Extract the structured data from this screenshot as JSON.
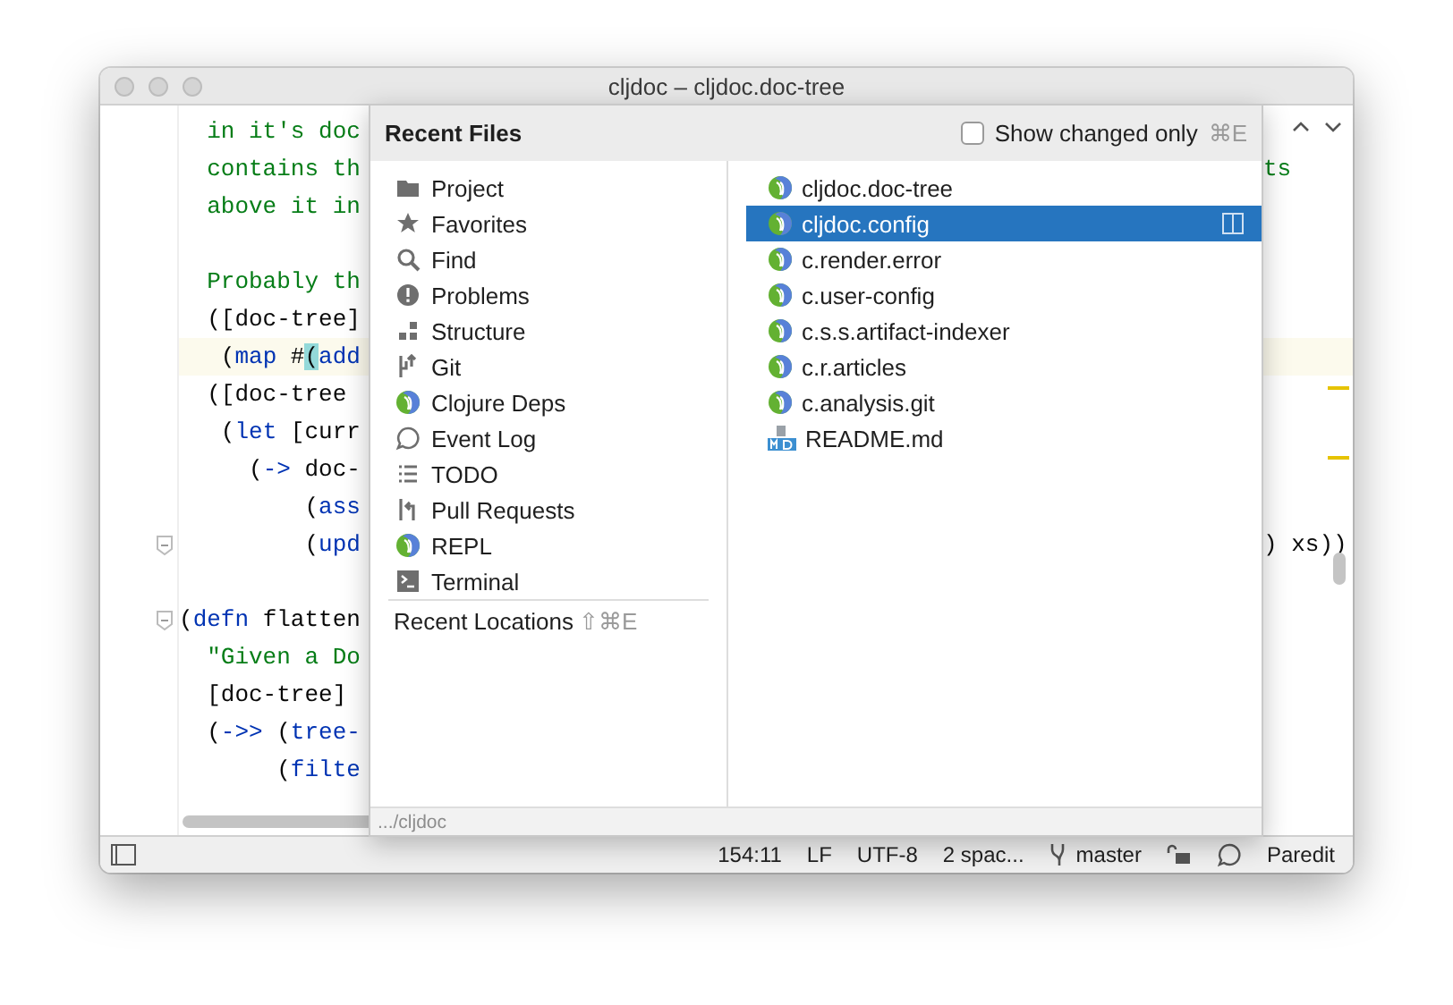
{
  "window": {
    "title": "cljdoc – cljdoc.doc-tree"
  },
  "editor": {
    "lines": [
      {
        "fold": false,
        "left": [
          {
            "kind": "string",
            "text": "  in it's doc"
          }
        ]
      },
      {
        "fold": false,
        "left": [
          {
            "kind": "string",
            "text": "  contains th"
          }
        ],
        "right": [
          {
            "kind": "string",
            "text": "ts"
          }
        ]
      },
      {
        "fold": false,
        "left": [
          {
            "kind": "string",
            "text": "  above it in"
          }
        ]
      },
      {
        "fold": false
      },
      {
        "fold": false,
        "left": [
          {
            "kind": "string",
            "text": "  Probably th"
          }
        ]
      },
      {
        "fold": false,
        "left": [
          {
            "kind": "plain",
            "text": "  ([doc-tree]"
          }
        ]
      },
      {
        "fold": false,
        "current": true,
        "left": [
          {
            "kind": "plain",
            "text": "   ("
          },
          {
            "kind": "keyword",
            "text": "map"
          },
          {
            "kind": "plain",
            "text": " #"
          },
          {
            "kind": "match",
            "text": "("
          },
          {
            "kind": "keyword",
            "text": "add"
          }
        ]
      },
      {
        "fold": false,
        "left": [
          {
            "kind": "plain",
            "text": "  ([doc-tree"
          }
        ]
      },
      {
        "fold": false,
        "left": [
          {
            "kind": "plain",
            "text": "   ("
          },
          {
            "kind": "keyword",
            "text": "let"
          },
          {
            "kind": "plain",
            "text": " [curr"
          }
        ]
      },
      {
        "fold": false,
        "left": [
          {
            "kind": "plain",
            "text": "     ("
          },
          {
            "kind": "keyword",
            "text": "->"
          },
          {
            "kind": "plain",
            "text": " doc-"
          }
        ]
      },
      {
        "fold": false,
        "left": [
          {
            "kind": "plain",
            "text": "         ("
          },
          {
            "kind": "keyword",
            "text": "ass"
          }
        ]
      },
      {
        "fold": true,
        "left": [
          {
            "kind": "plain",
            "text": "         ("
          },
          {
            "kind": "keyword",
            "text": "upd"
          }
        ],
        "right": [
          {
            "kind": "plain",
            "text": ") xs))"
          }
        ]
      },
      {
        "fold": false
      },
      {
        "fold": true,
        "left": [
          {
            "kind": "plain",
            "text": "("
          },
          {
            "kind": "keyword",
            "text": "defn"
          },
          {
            "kind": "plain",
            "text": " flatten"
          }
        ]
      },
      {
        "fold": false,
        "left": [
          {
            "kind": "string",
            "text": "  \"Given a Do"
          }
        ]
      },
      {
        "fold": false,
        "left": [
          {
            "kind": "plain",
            "text": "  [doc-tree]"
          }
        ]
      },
      {
        "fold": false,
        "left": [
          {
            "kind": "plain",
            "text": "  ("
          },
          {
            "kind": "keyword",
            "text": "->>"
          },
          {
            "kind": "plain",
            "text": " ("
          },
          {
            "kind": "keyword",
            "text": "tree-"
          }
        ]
      },
      {
        "fold": false,
        "left": [
          {
            "kind": "plain",
            "text": "       ("
          },
          {
            "kind": "keyword",
            "text": "filte"
          }
        ]
      }
    ]
  },
  "popup": {
    "title": "Recent Files",
    "show_changed": {
      "label": "Show changed only",
      "shortcut": "⌘E",
      "checked": false
    },
    "tool_windows": [
      {
        "label": "Project",
        "kind": "folder"
      },
      {
        "label": "Favorites",
        "kind": "star"
      },
      {
        "label": "Find",
        "kind": "search"
      },
      {
        "label": "Problems",
        "kind": "alert"
      },
      {
        "label": "Structure",
        "kind": "structure"
      },
      {
        "label": "Git",
        "kind": "vcs"
      },
      {
        "label": "Clojure Deps",
        "kind": "logo"
      },
      {
        "label": "Event Log",
        "kind": "bubble"
      },
      {
        "label": "TODO",
        "kind": "list"
      },
      {
        "label": "Pull Requests",
        "kind": "merge"
      },
      {
        "label": "REPL",
        "kind": "logo"
      },
      {
        "label": "Terminal",
        "kind": "terminal"
      }
    ],
    "recent_locations": {
      "label": "Recent Locations",
      "shortcut": "⇧⌘E"
    },
    "files": [
      {
        "name": "cljdoc.doc-tree",
        "kind": "clojure",
        "selected": false
      },
      {
        "name": "cljdoc.config",
        "kind": "clojure",
        "selected": true
      },
      {
        "name": "c.render.error",
        "kind": "clojure",
        "selected": false
      },
      {
        "name": "c.user-config",
        "kind": "clojure",
        "selected": false
      },
      {
        "name": "c.s.s.artifact-indexer",
        "kind": "clojure",
        "selected": false
      },
      {
        "name": "c.r.articles",
        "kind": "clojure",
        "selected": false
      },
      {
        "name": "c.analysis.git",
        "kind": "clojure",
        "selected": false
      },
      {
        "name": "README.md",
        "kind": "markdown",
        "selected": false
      }
    ],
    "path": ".../cljdoc"
  },
  "status_bar": {
    "position": "154:11",
    "line_separator": "LF",
    "encoding": "UTF-8",
    "indent": "2 spac...",
    "branch": "master",
    "mode": "Paredit"
  }
}
